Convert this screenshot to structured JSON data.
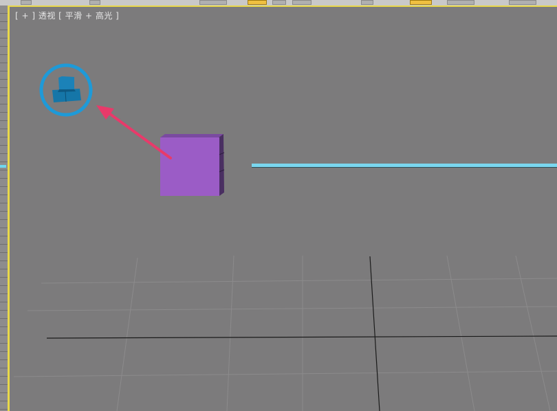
{
  "viewport": {
    "label": "[ + ] 透视 [ 平滑 + 高光 ]"
  },
  "colors": {
    "viewport_background": "#7c7b7c",
    "active_border": "#e8d84a",
    "box_front": "#9b5cc6",
    "box_side": "#4a2f62",
    "light_object": "#1576a8",
    "highlight_circle": "#1e9ad8",
    "annotation_arrow": "#e83a6a",
    "line_object": "#7ad6ee",
    "grid_line": "#8c8b8c",
    "axis_line": "#1a1a1a"
  },
  "icons": [
    "highlight-circle",
    "annotation-arrow",
    "purple-box",
    "light-icon",
    "cyan-line"
  ]
}
